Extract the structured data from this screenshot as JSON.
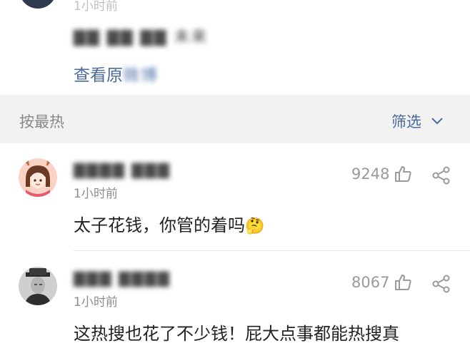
{
  "top_comment": {
    "time": "1小时前",
    "username_blurred": "▇▇ ▇▇ ▇▇ 未来",
    "view_original_label": "查看原",
    "view_original_blurred": "微博"
  },
  "sort_bar": {
    "sort_label": "按最热",
    "filter_label": "筛选"
  },
  "comments": [
    {
      "username_blurred": "▇▇▇▇ ▇▇▇",
      "time": "1小时前",
      "text": "太子花钱，你管的着吗",
      "emoji": "🤔",
      "like_count": "9248"
    },
    {
      "username_blurred": "▇▇▇ ▇▇▇▇",
      "time": "1小时前",
      "text": "这热搜也花了不少钱！屁大点事都能热搜真",
      "like_count": "8067"
    }
  ],
  "colors": {
    "link": "#4a6a9c",
    "sort_bar_bg": "#f2f2f2"
  }
}
